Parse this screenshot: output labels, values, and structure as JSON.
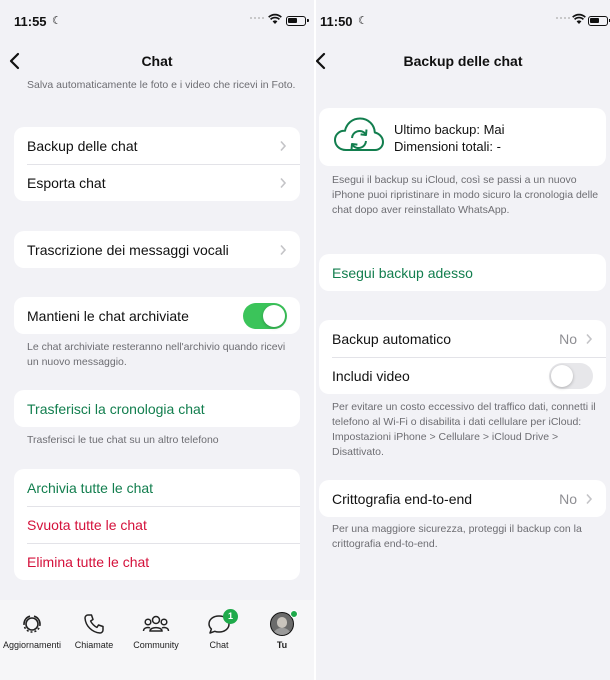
{
  "left": {
    "status": {
      "time": "11:55"
    },
    "nav": {
      "title": "Chat"
    },
    "intro_note": "Salva automaticamente le foto e i video che ricevi in Foto.",
    "items": {
      "backup": "Backup delle chat",
      "export": "Esporta chat",
      "transcription": "Trascrizione dei messaggi vocali",
      "keep_archived": "Mantieni le chat archiviate",
      "keep_archived_on": true,
      "archived_note": "Le chat archiviate resteranno nell'archivio quando ricevi un nuovo messaggio.",
      "transfer": "Trasferisci la cronologia chat",
      "transfer_note": "Trasferisci le tue chat su un altro telefono",
      "archive_all": "Archivia tutte le chat",
      "empty_all": "Svuota tutte le chat",
      "delete_all": "Elimina tutte le chat"
    },
    "tabbar": {
      "updates": "Aggiornamenti",
      "calls": "Chiamate",
      "community": "Community",
      "chat": "Chat",
      "chat_badge": "1",
      "you": "Tu"
    }
  },
  "right": {
    "status": {
      "time": "11:50"
    },
    "nav": {
      "title": "Backup delle chat"
    },
    "last_backup": "Ultimo backup: Mai",
    "total_size": "Dimensioni totali: -",
    "backup_note": "Esegui il backup su iCloud, così se passi a un nuovo iPhone puoi ripristinare in modo sicuro la cronologia delle chat dopo aver reinstallato WhatsApp.",
    "backup_now": "Esegui backup adesso",
    "auto_backup": "Backup automatico",
    "auto_backup_value": "No",
    "include_video": "Includi video",
    "include_video_on": false,
    "cellular_note": "Per evitare un costo eccessivo del traffico dati, connetti il telefono al Wi-Fi o disabilita i dati cellulare per iCloud: Impostazioni iPhone > Cellulare > iCloud Drive > Disattivato.",
    "e2e": "Crittografia end-to-end",
    "e2e_value": "No",
    "e2e_note": "Per una maggiore sicurezza, proteggi il backup con la crittografia end-to-end."
  },
  "colors": {
    "accent_green": "#127e4e",
    "destructive_red": "#d4113b",
    "toggle_on": "#3bc45a",
    "badge_green": "#1faa4b"
  }
}
